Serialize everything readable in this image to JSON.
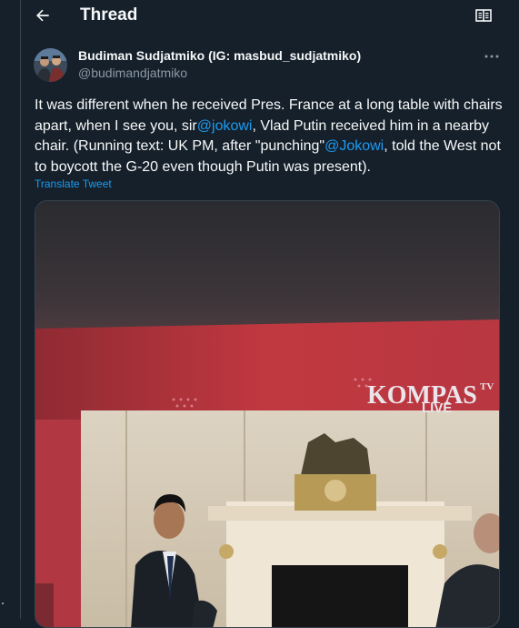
{
  "header": {
    "title": "Thread",
    "back_icon": "arrow-left-icon",
    "reader_icon": "reader-mode-icon"
  },
  "tweet": {
    "author_name": "Budiman Sudjatmiko (IG: masbud_sudjatmiko)",
    "author_handle": "@budimandjatmiko",
    "text_1": "It was different when he received Pres. France at a long table with chairs apart, when I see you, sir",
    "mention_1": "@jokowi",
    "text_2": ", Vlad Putin received him in a nearby chair. (Running text: UK PM, after \"punching\"",
    "mention_2": "@Jokowi",
    "text_3": ", told the West not to boycott the G-20 even though Putin was present).",
    "translate_label": "Translate Tweet"
  },
  "media": {
    "overlay_logo": "KOMPAS",
    "overlay_logo_suffix": "TV",
    "overlay_live": "LIVE"
  },
  "colors": {
    "background": "#15202b",
    "border": "#38444d",
    "accent": "#1d9bf0",
    "secondary_text": "#8b98a5"
  }
}
